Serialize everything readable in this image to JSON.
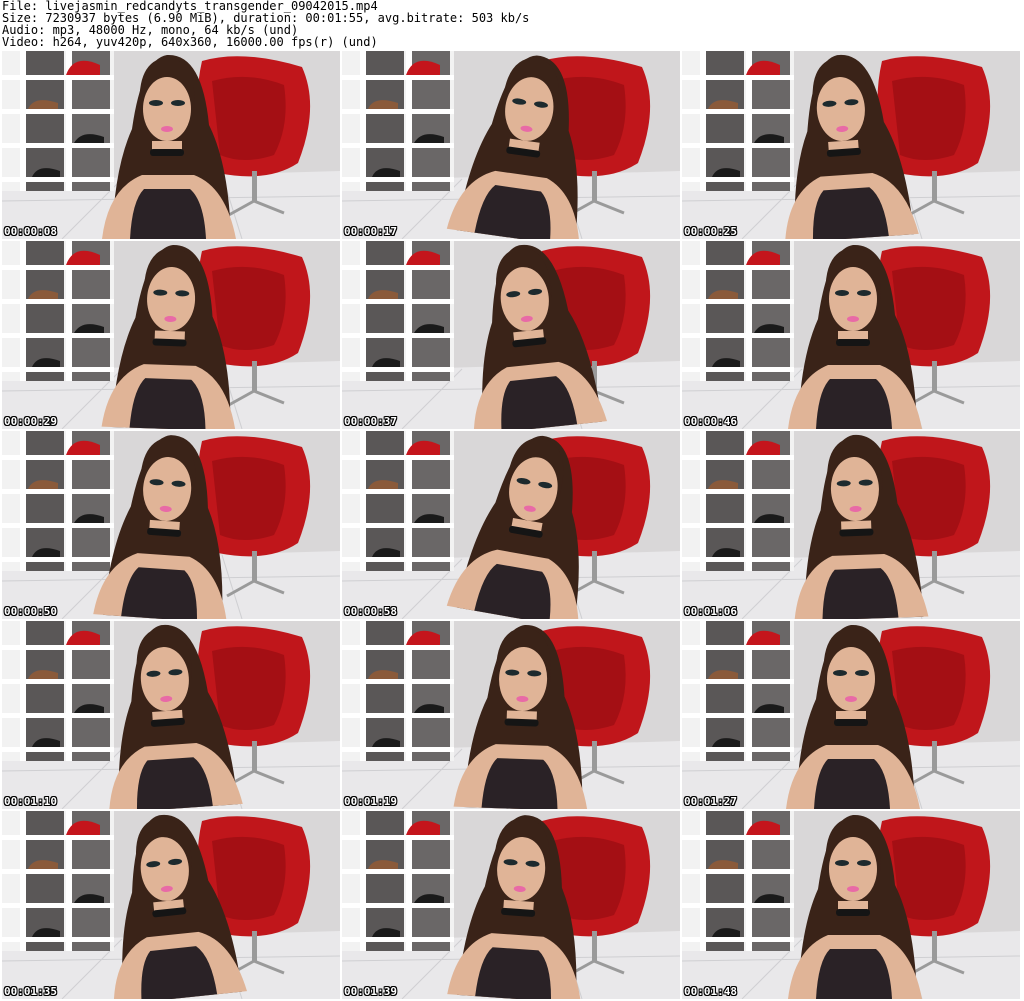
{
  "header": {
    "file_line": "File: livejasmin_redcandyts_transgender_09042015.mp4",
    "size_line": "Size: 7230937 bytes (6.90 MiB), duration: 00:01:55, avg.bitrate: 503 kb/s",
    "audio_line": "Audio: mp3, 48000 Hz, mono, 64 kb/s (und)",
    "video_line": "Video: h264, yuv420p, 640x360, 16000.00 fps(r) (und)"
  },
  "thumbnails": [
    {
      "timestamp": "00:00:08"
    },
    {
      "timestamp": "00:00:17"
    },
    {
      "timestamp": "00:00:25"
    },
    {
      "timestamp": "00:00:29"
    },
    {
      "timestamp": "00:00:37"
    },
    {
      "timestamp": "00:00:46"
    },
    {
      "timestamp": "00:00:50"
    },
    {
      "timestamp": "00:00:58"
    },
    {
      "timestamp": "00:01:06"
    },
    {
      "timestamp": "00:01:10"
    },
    {
      "timestamp": "00:01:19"
    },
    {
      "timestamp": "00:01:27"
    },
    {
      "timestamp": "00:01:35"
    },
    {
      "timestamp": "00:01:39"
    },
    {
      "timestamp": "00:01:48"
    }
  ],
  "colors": {
    "wall": "#d9d7d8",
    "floor": "#e9e8ea",
    "shelf": "#f2f2f2",
    "chair": "#c0161b",
    "hair": "#3a2318",
    "skin": "#e0b497",
    "dress": "#2a2226",
    "lips": "#e86aa6"
  }
}
